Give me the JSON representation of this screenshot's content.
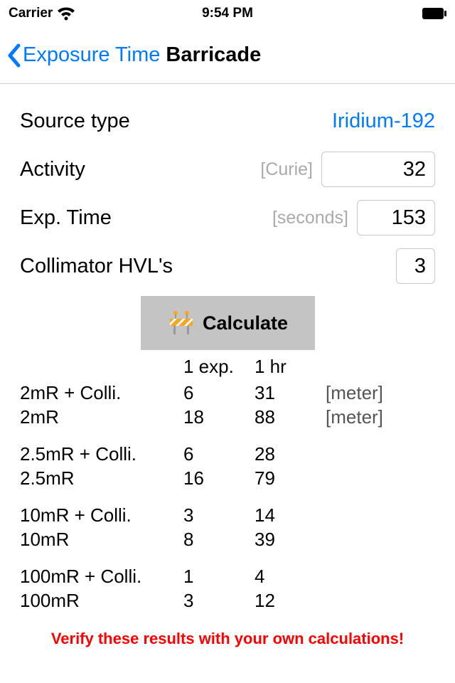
{
  "statusBar": {
    "carrier": "Carrier",
    "time": "9:54 PM"
  },
  "nav": {
    "back": "Exposure Time",
    "title": "Barricade"
  },
  "form": {
    "sourceType": {
      "label": "Source type",
      "value": "Iridium-192"
    },
    "activity": {
      "label": "Activity",
      "unit": "[Curie]",
      "value": "32"
    },
    "expTime": {
      "label": "Exp. Time",
      "unit": "[seconds]",
      "value": "153"
    },
    "collimator": {
      "label": "Collimator HVL's",
      "value": "3"
    }
  },
  "calculateLabel": "Calculate",
  "results": {
    "headers": {
      "col1": "1 exp.",
      "col2": "1 hr"
    },
    "unitLabel": "[meter]",
    "groups": [
      {
        "row1": {
          "label": "2mR + Colli.",
          "exp": "6",
          "hr": "31",
          "showUnit": true
        },
        "row2": {
          "label": "2mR",
          "exp": "18",
          "hr": "88",
          "showUnit": true
        }
      },
      {
        "row1": {
          "label": "2.5mR + Colli.",
          "exp": "6",
          "hr": "28"
        },
        "row2": {
          "label": "2.5mR",
          "exp": "16",
          "hr": "79"
        }
      },
      {
        "row1": {
          "label": "10mR + Colli.",
          "exp": "3",
          "hr": "14"
        },
        "row2": {
          "label": "10mR",
          "exp": "8",
          "hr": "39"
        }
      },
      {
        "row1": {
          "label": "100mR + Colli.",
          "exp": "1",
          "hr": "4"
        },
        "row2": {
          "label": "100mR",
          "exp": "3",
          "hr": "12"
        }
      }
    ]
  },
  "disclaimer": "Verify these results with your own calculations!"
}
